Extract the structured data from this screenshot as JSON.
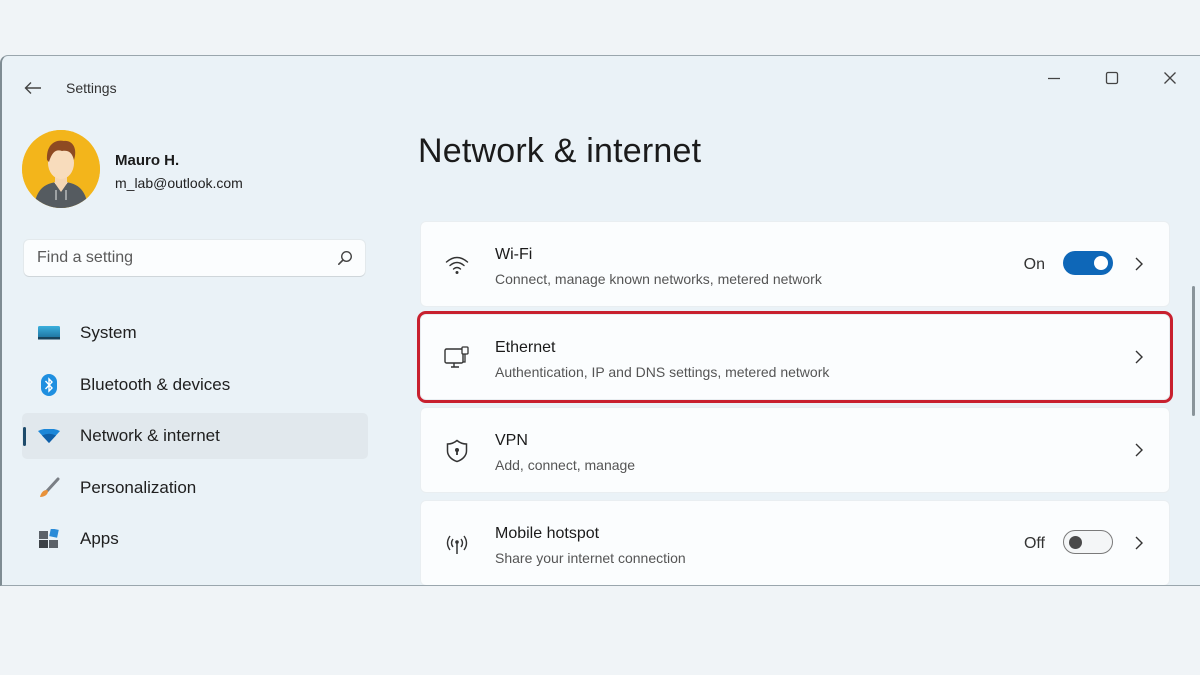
{
  "window": {
    "app_title": "Settings",
    "controls": {
      "minimize": "minimize",
      "maximize": "maximize",
      "close": "close"
    }
  },
  "profile": {
    "name": "Mauro H.",
    "email": "m_lab@outlook.com"
  },
  "search": {
    "placeholder": "Find a setting",
    "value": ""
  },
  "sidebar": {
    "items": [
      {
        "label": "System",
        "icon": "monitor-icon",
        "active": false
      },
      {
        "label": "Bluetooth & devices",
        "icon": "bluetooth-icon",
        "active": false
      },
      {
        "label": "Network & internet",
        "icon": "wifi-icon",
        "active": true
      },
      {
        "label": "Personalization",
        "icon": "brush-icon",
        "active": false
      },
      {
        "label": "Apps",
        "icon": "apps-icon",
        "active": false
      }
    ]
  },
  "main": {
    "title": "Network & internet",
    "cards": [
      {
        "title": "Wi-Fi",
        "subtitle": "Connect, manage known networks, metered network",
        "icon": "wifi-icon",
        "state_label": "On",
        "toggle": true,
        "highlighted": false
      },
      {
        "title": "Ethernet",
        "subtitle": "Authentication, IP and DNS settings, metered network",
        "icon": "ethernet-icon",
        "highlighted": true
      },
      {
        "title": "VPN",
        "subtitle": "Add, connect, manage",
        "icon": "shield-icon",
        "highlighted": false
      },
      {
        "title": "Mobile hotspot",
        "subtitle": "Share your internet connection",
        "icon": "hotspot-icon",
        "state_label": "Off",
        "toggle": false,
        "highlighted": false
      }
    ]
  },
  "colors": {
    "accent": "#0e67b8",
    "highlight_border": "#c8202e",
    "window_bg": "#eaf2f7",
    "card_bg": "#fbfdfe"
  }
}
